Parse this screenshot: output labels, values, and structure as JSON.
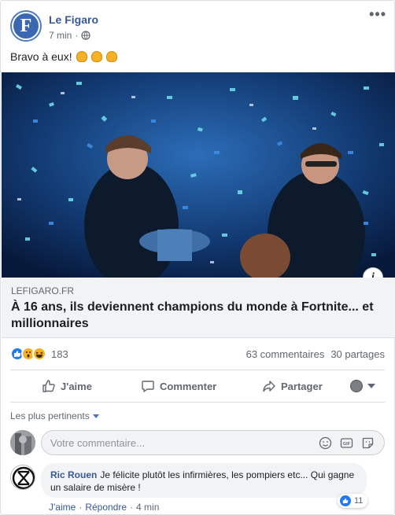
{
  "post": {
    "page_name": "Le Figaro",
    "avatar_letter": "F",
    "time": "7 min",
    "text": "Bravo à eux!",
    "more_label": "•••"
  },
  "link_preview": {
    "domain": "LEFIGARO.FR",
    "headline": "À 16 ans, ils deviennent champions du monde à Fortnite... et millionnaires",
    "info_label": "i"
  },
  "engagement": {
    "reaction_count": "183",
    "comments": "63 commentaires",
    "shares": "30 partages"
  },
  "actions": {
    "like": "J'aime",
    "comment": "Commenter",
    "share": "Partager"
  },
  "comments_section": {
    "sort_label": "Les plus pertinents",
    "input_placeholder": "Votre commentaire...",
    "first_comment": {
      "author": "Ric Rouen",
      "text": "Je félicite plutôt les infirmières, les pompiers etc... Qui gagne un salaire de misère !",
      "like_count": "11",
      "like_action": "J'aime",
      "reply_action": "Répondre",
      "separator": "·",
      "time": "4 min"
    }
  },
  "colors": {
    "link_blue": "#385898",
    "like_blue": "#2078f4",
    "reaction_yellow": "#f7b125",
    "border": "#dddfe2",
    "muted_text": "#606770"
  }
}
